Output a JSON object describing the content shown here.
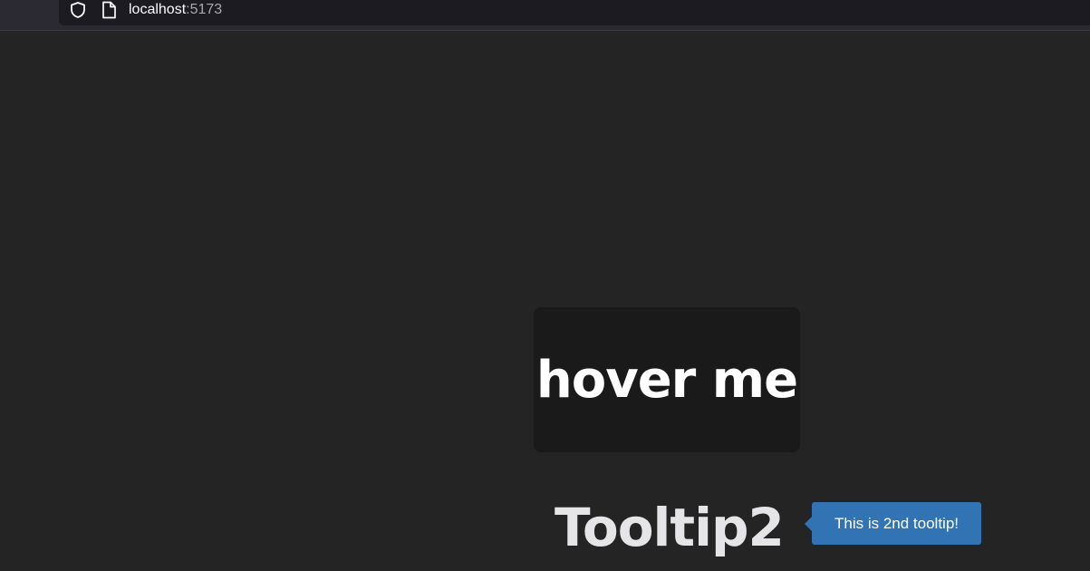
{
  "browser": {
    "url_host": "localhost",
    "url_port": ":5173",
    "icons": [
      "shield-icon",
      "page-icon"
    ]
  },
  "main": {
    "hover_label": "hover me",
    "tooltip2_title": "Tooltip2",
    "tooltip_text": "This is 2nd tooltip!"
  },
  "colors": {
    "background": "#242424",
    "tooltip": "#3273b3",
    "hover_box": "#1a1a1a"
  }
}
